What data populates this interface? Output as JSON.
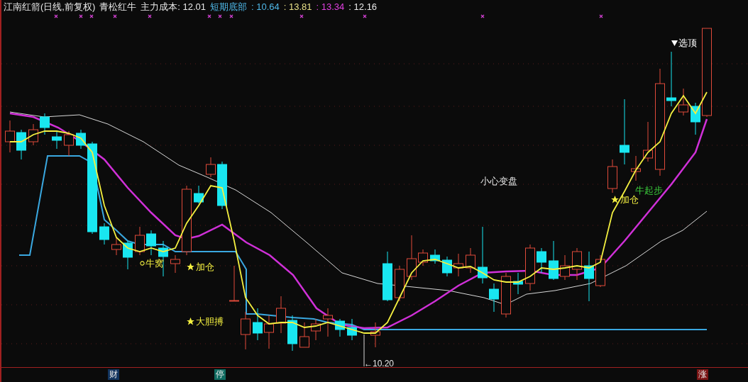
{
  "header": {
    "title": "江南红箭(日线,前复权)",
    "indicator": "青松红牛",
    "main_cost": "主力成本: 12.01",
    "series_label": {
      "text": "短期底部",
      "color": "#4fb8e8"
    },
    "series_values": [
      {
        "text": ": 10.64",
        "color": "#4fb8e8"
      },
      {
        "text": ": 13.81",
        "color": "#e8e088"
      },
      {
        "text": ": 13.34",
        "color": "#e040e0"
      },
      {
        "text": ": 12.16",
        "color": "#e8e8e8"
      }
    ]
  },
  "annotations": [
    {
      "text": "小心变盘",
      "kind": "plain",
      "color": "#e8e8e8"
    },
    {
      "text": "牛起步",
      "kind": "plain",
      "color": "#3ccf3c"
    },
    {
      "text": "加仓",
      "kind": "star",
      "color": "#f4f040"
    },
    {
      "text": "选顶",
      "kind": "triangle",
      "color": "#ffffff"
    },
    {
      "text": "牛窝",
      "kind": "circle",
      "color": "#f4f040"
    },
    {
      "text": "加仓",
      "kind": "star",
      "color": "#f4f040"
    },
    {
      "text": "大胆搏",
      "kind": "star",
      "color": "#f4f040"
    }
  ],
  "low_marker": "←10.20",
  "badges": [
    {
      "text": "财",
      "kind": "finance"
    },
    {
      "text": "停",
      "kind": "halt"
    },
    {
      "text": "涨",
      "kind": "rise"
    }
  ]
}
